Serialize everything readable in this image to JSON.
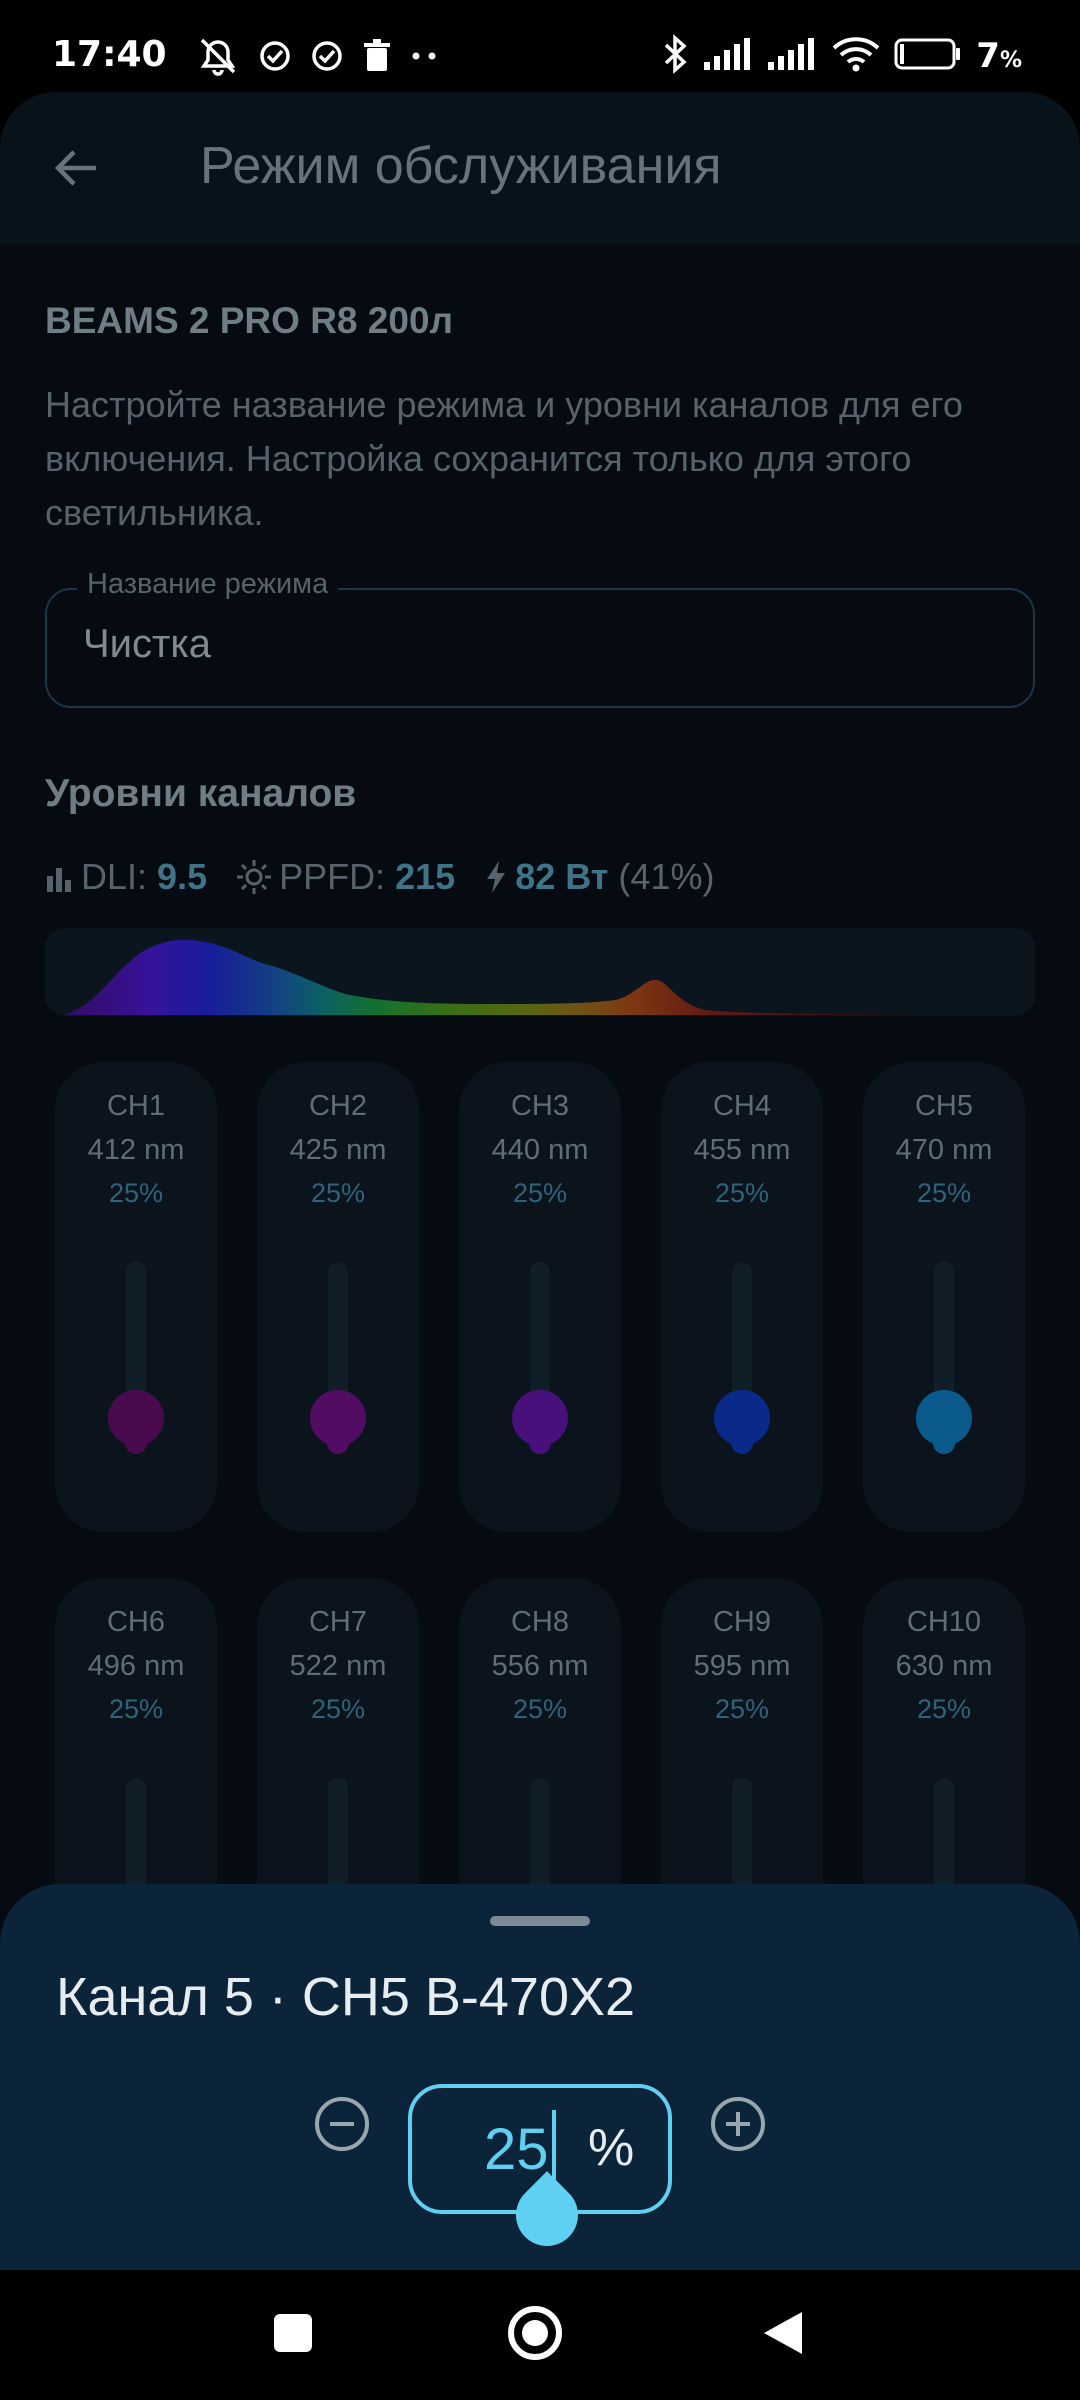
{
  "status_bar": {
    "time": "17:40",
    "battery": "7",
    "battery_unit": "%"
  },
  "app_bar": {
    "title": "Режим обслуживания",
    "back_icon": "arrow-back-icon"
  },
  "device_name": "BEAMS 2 PRO R8 200л",
  "description": "Настройте название режима и уровни каналов для его включения. Настройка сохранится только для этого светильника.",
  "mode_field": {
    "label": "Название режима",
    "value": "Чистка"
  },
  "channels_section": {
    "title": "Уровни каналов",
    "dli_label": "DLI:",
    "dli_value": "9.5",
    "ppfd_label": "PPFD:",
    "ppfd_value": "215",
    "power_value": "82 Вт",
    "power_pct": "(41%)"
  },
  "channels": [
    {
      "name": "CH1",
      "wavelength": "412 nm",
      "level": "25%",
      "color": "#4a0a4f"
    },
    {
      "name": "CH2",
      "wavelength": "425 nm",
      "level": "25%",
      "color": "#520d63"
    },
    {
      "name": "CH3",
      "wavelength": "440 nm",
      "level": "25%",
      "color": "#47107a"
    },
    {
      "name": "CH4",
      "wavelength": "455 nm",
      "level": "25%",
      "color": "#0a2a8a"
    },
    {
      "name": "CH5",
      "wavelength": "470 nm",
      "level": "25%",
      "color": "#0a5b8c"
    },
    {
      "name": "CH6",
      "wavelength": "496 nm",
      "level": "25%",
      "color": "#0b6a7c"
    },
    {
      "name": "CH7",
      "wavelength": "522 nm",
      "level": "25%",
      "color": "#0f7a3a"
    },
    {
      "name": "CH8",
      "wavelength": "556 nm",
      "level": "25%",
      "color": "#5a7a10"
    },
    {
      "name": "CH9",
      "wavelength": "595 nm",
      "level": "25%",
      "color": "#8a5a10"
    },
    {
      "name": "CH10",
      "wavelength": "630 nm",
      "level": "25%",
      "color": "#8a2a10"
    }
  ],
  "bottom_sheet": {
    "title": "Канал 5 · CH5 B-470X2",
    "value": "25",
    "unit": "%",
    "accent_color": "#5fd0f2"
  }
}
